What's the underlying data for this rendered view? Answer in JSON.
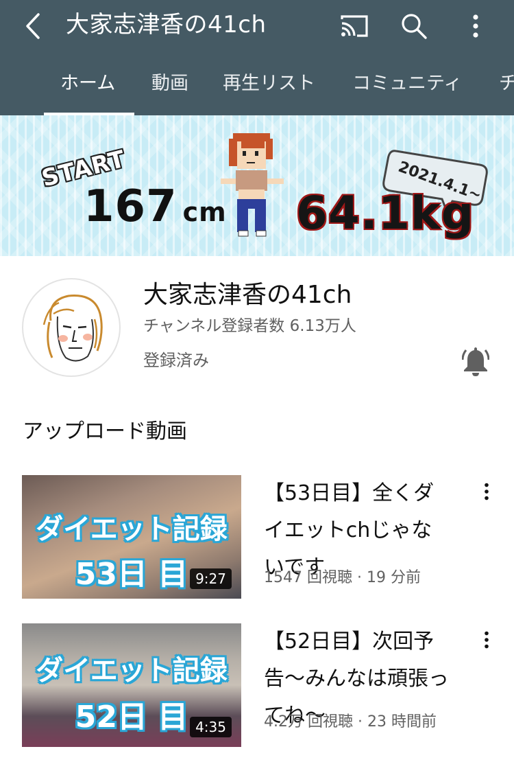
{
  "header": {
    "title": "大家志津香の41ch",
    "back_icon": "chevron-left-icon",
    "cast_icon": "cast-icon",
    "search_icon": "search-icon",
    "more_icon": "more-vert-icon",
    "background_color": "#455a64"
  },
  "tabs": [
    {
      "label": "ホーム",
      "active": true
    },
    {
      "label": "動画",
      "active": false
    },
    {
      "label": "再生リスト",
      "active": false
    },
    {
      "label": "コミュニティ",
      "active": false
    },
    {
      "label": "チ",
      "active": false
    }
  ],
  "banner": {
    "start_label": "START",
    "height_value": "167",
    "height_unit": "cm",
    "weight_value": "64.1kg",
    "date_label": "2021.4.1~",
    "background_color": "#c8ecf6"
  },
  "channel": {
    "name": "大家志津香の41ch",
    "subscribers": "チャンネル登録者数 6.13万人",
    "subscribed_label": "登録済み",
    "bell_icon": "bell-icon"
  },
  "section": {
    "title": "アップロード動画"
  },
  "videos": [
    {
      "title": "【53日目】全くダイエットchじゃないです",
      "meta": "1547 回視聴 · 19 分前",
      "duration": "9:27",
      "thumb_line1": "ダイエット記録",
      "thumb_line2": "53日 目"
    },
    {
      "title": "【52日目】次回予告～みんなは頑張ってね～",
      "meta": "4.2万 回視聴 · 23 時間前",
      "duration": "4:35",
      "thumb_line1": "ダイエット記録",
      "thumb_line2": "52日 目"
    }
  ]
}
